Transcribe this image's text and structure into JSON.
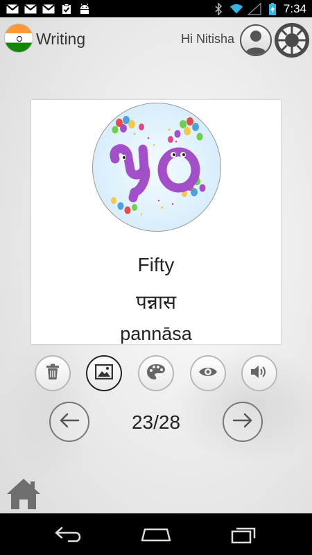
{
  "status_bar": {
    "time": "7:34",
    "notification_icons": [
      "gmail-icon",
      "gmail-icon",
      "gmail-icon",
      "clipboard-check-icon",
      "android-icon"
    ],
    "system_icons": [
      "bluetooth-icon",
      "wifi-icon",
      "signal-icon",
      "battery-charging-icon"
    ]
  },
  "header": {
    "title": "Writing",
    "greeting": "Hi Nitisha",
    "flag_icon": "india-flag-icon",
    "avatar_icon": "user-avatar-icon",
    "settings_icon": "settings-ring-icon"
  },
  "card": {
    "image_icon": "number-fifty-devanagari-balloons",
    "english": "Fifty",
    "hindi": "पन्नास",
    "transliteration": "pannāsa"
  },
  "tools": [
    {
      "name": "delete",
      "icon": "trash-icon",
      "active": false
    },
    {
      "name": "image",
      "icon": "image-icon",
      "active": true
    },
    {
      "name": "palette",
      "icon": "palette-icon",
      "active": false
    },
    {
      "name": "view",
      "icon": "eye-icon",
      "active": false
    },
    {
      "name": "sound",
      "icon": "speaker-icon",
      "active": false
    }
  ],
  "pager": {
    "counter": "23/28",
    "prev_icon": "arrow-left-icon",
    "next_icon": "arrow-right-icon"
  },
  "home_icon": "home-icon",
  "nav_bar": {
    "icons": [
      "back-icon",
      "home-outline-icon",
      "recent-apps-icon"
    ]
  },
  "colors": {
    "status_bar_bg": "#000000",
    "digit_purple": "#a24fc9",
    "active_border": "#222222"
  }
}
